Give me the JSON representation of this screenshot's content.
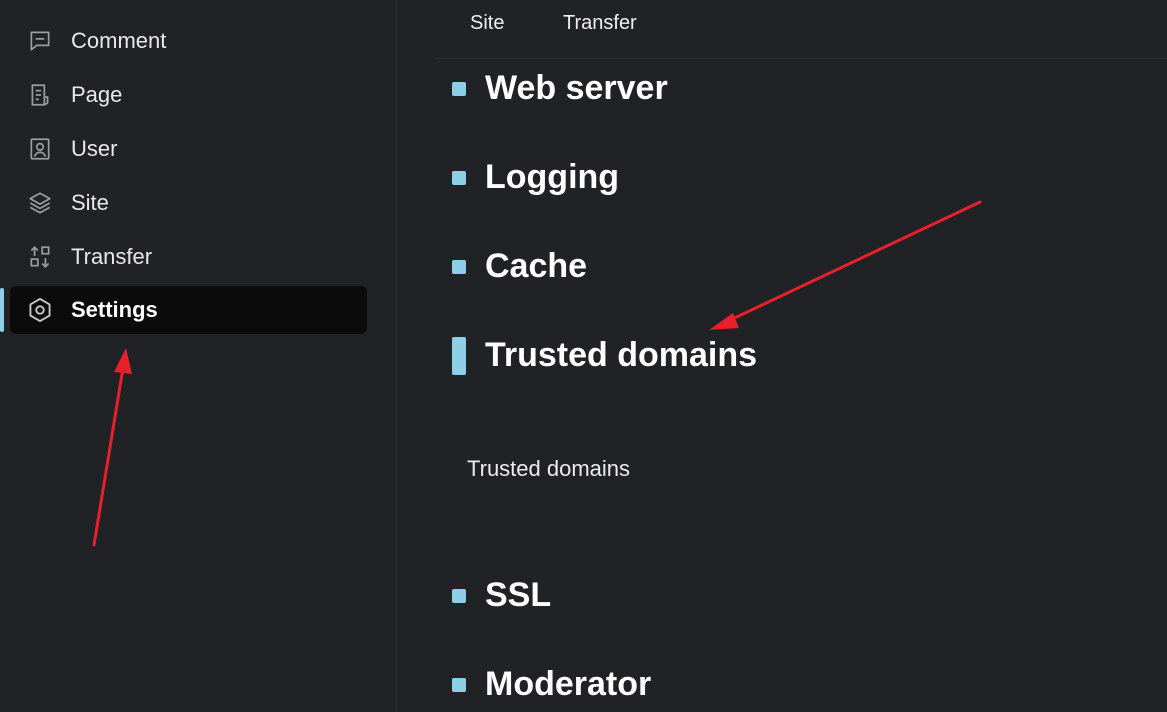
{
  "sidebar": {
    "items": [
      {
        "label": "Comment",
        "icon": "comment-icon"
      },
      {
        "label": "Page",
        "icon": "page-icon"
      },
      {
        "label": "User",
        "icon": "user-icon"
      },
      {
        "label": "Site",
        "icon": "layers-icon"
      },
      {
        "label": "Transfer",
        "icon": "transfer-icon"
      },
      {
        "label": "Settings",
        "icon": "settings-icon",
        "active": true
      }
    ]
  },
  "tabs": [
    "Site",
    "Transfer"
  ],
  "sections": [
    {
      "title": "Web server"
    },
    {
      "title": "Logging"
    },
    {
      "title": "Cache"
    },
    {
      "title": "Trusted domains",
      "active": true
    },
    {
      "title": "SSL"
    },
    {
      "title": "Moderator"
    }
  ],
  "content": {
    "trusted_domains_text": "Trusted domains"
  },
  "colors": {
    "background": "#202225",
    "accent": "#8ccfe6",
    "active_item_bg": "#0b0b0c",
    "annotation_arrow": "#e8202a"
  }
}
